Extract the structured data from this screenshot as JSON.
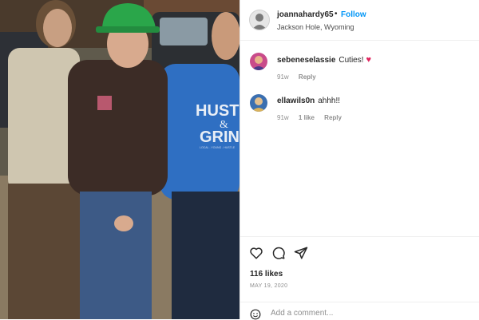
{
  "post": {
    "username": "joannahardy65",
    "separator": "•",
    "follow_label": "Follow",
    "location": "Jackson Hole, Wyoming"
  },
  "photo": {
    "hoodie_text": [
      "HUSTL",
      "&",
      "GRIN"
    ],
    "hoodie_small_text": "LOCAL - YOUNG - HUSTLE"
  },
  "comments": [
    {
      "username": "sebeneselassie",
      "text": "Cuties!",
      "emoji": "heart",
      "age": "91w",
      "reply_label": "Reply"
    },
    {
      "username": "ellawils0n",
      "text": "ahhh!!",
      "age": "91w",
      "likes_label": "1 like",
      "reply_label": "Reply"
    }
  ],
  "actions": {
    "icons": [
      "heart-icon",
      "comment-icon",
      "share-icon"
    ]
  },
  "likes": "116 likes",
  "date": "MAY 19, 2020",
  "add_comment": {
    "placeholder": "Add a comment...",
    "icon": "smiley-icon"
  },
  "colors": {
    "follow": "#0095f6",
    "heart": "#e0245e",
    "meta": "#8e8e8e"
  }
}
